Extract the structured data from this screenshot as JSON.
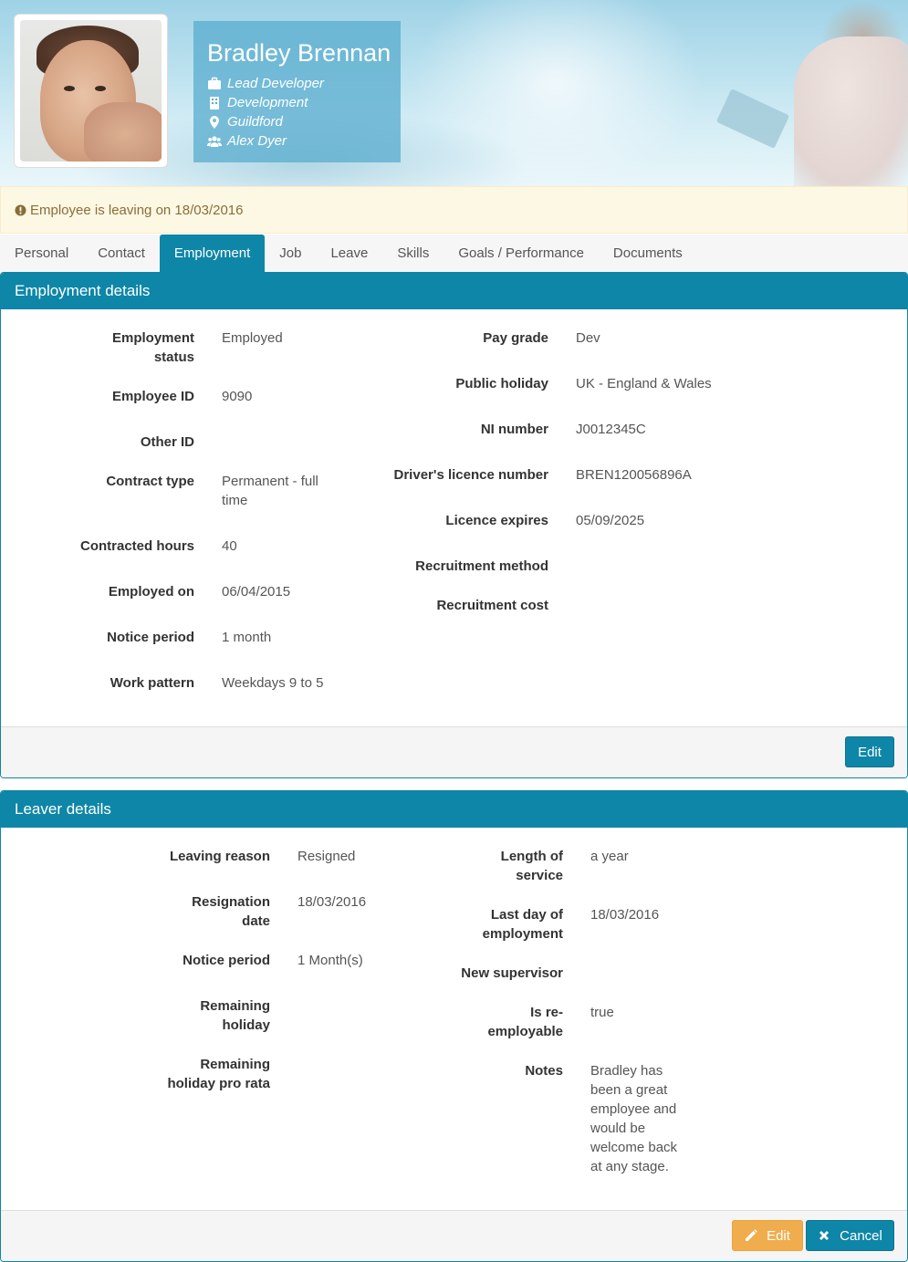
{
  "profile": {
    "name": "Bradley Brennan",
    "job_title": "Lead Developer",
    "department": "Development",
    "location": "Guildford",
    "manager": "Alex Dyer"
  },
  "alert": {
    "text": "Employee is leaving on 18/03/2016"
  },
  "tabs": [
    {
      "label": "Personal"
    },
    {
      "label": "Contact"
    },
    {
      "label": "Employment",
      "active": true
    },
    {
      "label": "Job"
    },
    {
      "label": "Leave"
    },
    {
      "label": "Skills"
    },
    {
      "label": "Goals / Performance"
    },
    {
      "label": "Documents"
    }
  ],
  "employment": {
    "title": "Employment details",
    "left": [
      {
        "label_l1": "Employment",
        "label_l2": "status",
        "value": "Employed"
      },
      {
        "label_l1": "Employee ID",
        "value": "9090"
      },
      {
        "label_l1": "Other ID",
        "value": ""
      },
      {
        "label_l1": "Contract type",
        "value_l1": "Permanent - full",
        "value_l2": "time"
      },
      {
        "label_l1": "Contracted hours",
        "value": "40"
      },
      {
        "label_l1": "Employed on",
        "value": "06/04/2015"
      },
      {
        "label_l1": "Notice period",
        "value": "1 month"
      },
      {
        "label_l1": "Work pattern",
        "value": "Weekdays 9 to 5"
      }
    ],
    "right": [
      {
        "label": "Pay grade",
        "value": "Dev"
      },
      {
        "label": "Public holiday",
        "value": "UK - England & Wales"
      },
      {
        "label": "NI number",
        "value": "J0012345C"
      },
      {
        "label": "Driver's licence number",
        "value": "BREN120056896A"
      },
      {
        "label": "Licence expires",
        "value": "05/09/2025"
      },
      {
        "label": "Recruitment method",
        "value": ""
      },
      {
        "label": "Recruitment cost",
        "value": ""
      }
    ],
    "edit_label": "Edit"
  },
  "leaver": {
    "title": "Leaver details",
    "left": [
      {
        "label_l1": "Leaving reason",
        "value": "Resigned"
      },
      {
        "label_l1": "Resignation",
        "label_l2": "date",
        "value": "18/03/2016"
      },
      {
        "label_l1": "Notice period",
        "value": "1 Month(s)"
      },
      {
        "label_l1": "Remaining",
        "label_l2": "holiday",
        "value": ""
      },
      {
        "label_l1": "Remaining",
        "label_l2": "holiday pro rata",
        "value": ""
      }
    ],
    "right": [
      {
        "label_l1": "Length of",
        "label_l2": "service",
        "value": "a year"
      },
      {
        "label_l1": "Last day of",
        "label_l2": "employment",
        "value": "18/03/2016"
      },
      {
        "label_l1": "New supervisor",
        "value": ""
      },
      {
        "label_l1": "Is re-",
        "label_l2": "employable",
        "value": "true"
      },
      {
        "label_l1": "Notes",
        "value_lines": [
          "Bradley has",
          "been a great",
          "employee and",
          "would be",
          "welcome back",
          "at any stage."
        ]
      }
    ],
    "edit_label": "Edit",
    "cancel_label": "Cancel"
  },
  "colors": {
    "primary": "#0e86a7",
    "warning": "#f0ad4e",
    "alert_bg": "#fcf8e3",
    "alert_text": "#8a6d3b"
  },
  "icons": [
    "briefcase-icon",
    "building-icon",
    "map-marker-icon",
    "users-icon",
    "exclamation-circle-icon",
    "pencil-icon",
    "times-icon"
  ]
}
